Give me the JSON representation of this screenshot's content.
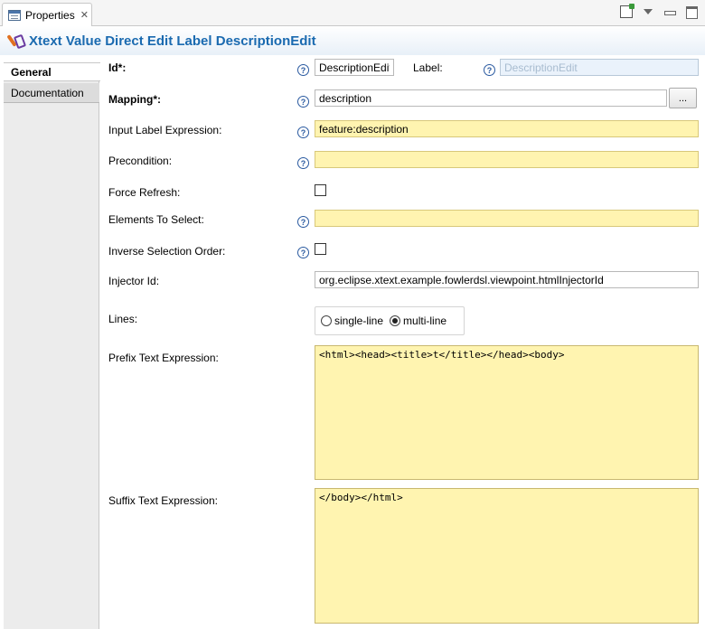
{
  "view_tab": {
    "label": "Properties",
    "close": "✕"
  },
  "header": {
    "title": "Xtext Value Direct Edit Label DescriptionEdit"
  },
  "side_tabs": [
    {
      "label": "General",
      "active": true
    },
    {
      "label": "Documentation",
      "active": false
    }
  ],
  "form": {
    "id": {
      "label": "Id*:",
      "value": "DescriptionEdit"
    },
    "label": {
      "label": "Label:",
      "value": "DescriptionEdit"
    },
    "mapping": {
      "label": "Mapping*:",
      "value": "description",
      "browse": "..."
    },
    "input_label_expression": {
      "label": "Input Label Expression:",
      "value": "feature:description"
    },
    "precondition": {
      "label": "Precondition:",
      "value": ""
    },
    "force_refresh": {
      "label": "Force Refresh:",
      "checked": false
    },
    "elements_to_select": {
      "label": "Elements To Select:",
      "value": ""
    },
    "inverse_selection_order": {
      "label": "Inverse Selection Order:",
      "checked": false
    },
    "injector_id": {
      "label": "Injector Id:",
      "value": "org.eclipse.xtext.example.fowlerdsl.viewpoint.htmlInjectorId"
    },
    "lines": {
      "label": "Lines:",
      "options": [
        "single-line",
        "multi-line"
      ],
      "selected": "multi-line"
    },
    "prefix_text_expression": {
      "label": "Prefix Text Expression:",
      "value": "<html><head><title>t</title></head><body>"
    },
    "suffix_text_expression": {
      "label": "Suffix Text Expression:",
      "value": "</body></html>"
    }
  },
  "help_glyph": "?",
  "colors": {
    "accent": "#1a6ab0",
    "field_yellow": "#fff4b0",
    "help_blue": "#2a5aa0"
  }
}
